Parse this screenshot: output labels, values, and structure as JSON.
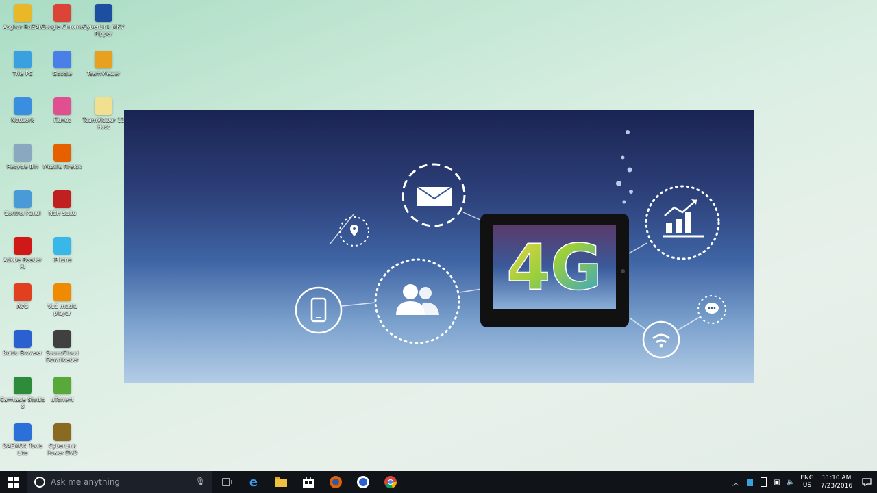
{
  "desktop": {
    "icons": [
      {
        "label": "Asghar RaZAb",
        "icon": "folder-icon",
        "color": "#e8b828"
      },
      {
        "label": "Google Chrome",
        "icon": "chrome-icon",
        "color": "#db4437"
      },
      {
        "label": "CyberLink MKV Ripper",
        "icon": "cyberlink-icon",
        "color": "#1d4fa0"
      },
      {
        "label": "This PC",
        "icon": "computer-icon",
        "color": "#3aa0e0"
      },
      {
        "label": "Google",
        "icon": "google-icon",
        "color": "#4a7fe8"
      },
      {
        "label": "TeamViewer",
        "icon": "teamviewer-icon",
        "color": "#e8a020"
      },
      {
        "label": "Network",
        "icon": "network-icon",
        "color": "#3a8ee0"
      },
      {
        "label": "iTunes",
        "icon": "itunes-icon",
        "color": "#e05090"
      },
      {
        "label": "TeamViewer 11 Host",
        "icon": "file-icon",
        "color": "#f0e090"
      },
      {
        "label": "Recycle Bin",
        "icon": "recycle-bin-icon",
        "color": "#8aa8c0"
      },
      {
        "label": "Mozilla Firefox",
        "icon": "firefox-icon",
        "color": "#e66000"
      },
      {
        "label": "Control Panel",
        "icon": "control-panel-icon",
        "color": "#4a9ad8"
      },
      {
        "label": "NCH Suite",
        "icon": "nch-icon",
        "color": "#c02020"
      },
      {
        "label": "Adobe Reader XI",
        "icon": "pdf-icon",
        "color": "#d01818"
      },
      {
        "label": "iPhone",
        "icon": "phone-app-icon",
        "color": "#38b8e8"
      },
      {
        "label": "AVG",
        "icon": "avg-icon",
        "color": "#e04020"
      },
      {
        "label": "VLC media player",
        "icon": "vlc-icon",
        "color": "#f08a00"
      },
      {
        "label": "Baidu Browser",
        "icon": "baidu-icon",
        "color": "#2a60d0"
      },
      {
        "label": "SoundCloud Downloader",
        "icon": "soundcloud-icon",
        "color": "#404040"
      },
      {
        "label": "Camtasia Studio 8",
        "icon": "camtasia-icon",
        "color": "#2e8b3a"
      },
      {
        "label": "uTorrent",
        "icon": "utorrent-icon",
        "color": "#58a83a"
      },
      {
        "label": "DAEMON Tools Lite",
        "icon": "daemon-tools-icon",
        "color": "#2a70d8"
      },
      {
        "label": "CyberLink Power DVD",
        "icon": "powerdvd-icon",
        "color": "#8a6a20"
      }
    ]
  },
  "banner": {
    "headline": "4G"
  },
  "taskbar": {
    "search_placeholder": "Ask me anything",
    "language_line1": "ENG",
    "language_line2": "US",
    "time": "11:10 AM",
    "date": "7/23/2016"
  }
}
